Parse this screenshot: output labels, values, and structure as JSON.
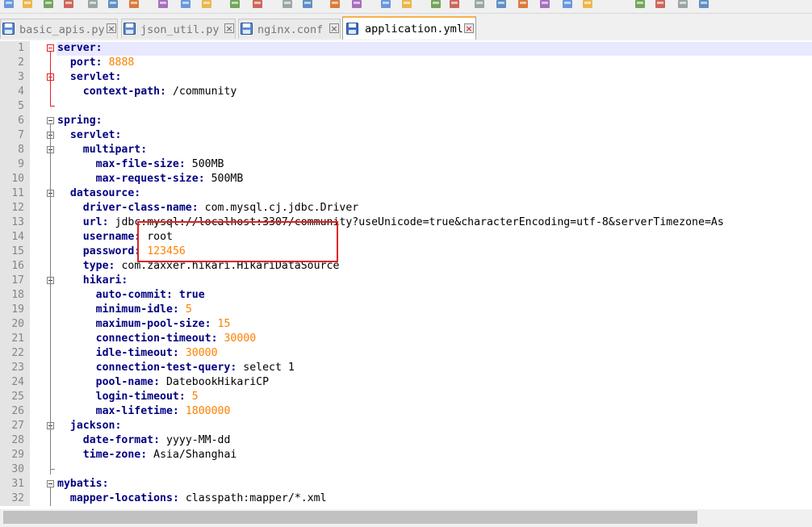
{
  "toolbar": {
    "buttons": [
      "new-file-icon",
      "open-folder-icon",
      "save-icon",
      "save-all-icon",
      "close-icon",
      "close-all-icon",
      "print-icon",
      "cut-icon",
      "copy-icon",
      "paste-icon",
      "undo-icon",
      "redo-icon",
      "find-icon",
      "replace-icon",
      "zoom-in-icon",
      "zoom-out-icon",
      "sync-vertical-icon",
      "sync-horizontal-icon",
      "word-wrap-icon",
      "show-all-chars-icon",
      "indent-guide-icon",
      "document-map-icon",
      "function-list-icon",
      "folder-as-workspace-icon",
      "monitoring-icon",
      "record-macro-icon",
      "stop-recording-icon",
      "playback-macro-icon",
      "run-macro-multiple-icon",
      "save-macro-icon"
    ]
  },
  "tabs": [
    {
      "label": "basic_apis.py",
      "active": false
    },
    {
      "label": "json_util.py",
      "active": false
    },
    {
      "label": "nginx.conf",
      "active": false
    },
    {
      "label": "application.yml",
      "active": true
    }
  ],
  "editor": {
    "lines": [
      {
        "num": "1",
        "indent": 0,
        "key": "server",
        "value": "",
        "vtype": ""
      },
      {
        "num": "2",
        "indent": 2,
        "key": "port",
        "value": "8888",
        "vtype": "num"
      },
      {
        "num": "3",
        "indent": 2,
        "key": "servlet",
        "value": "",
        "vtype": ""
      },
      {
        "num": "4",
        "indent": 4,
        "key": "context-path",
        "value": "/community",
        "vtype": "val"
      },
      {
        "num": "5",
        "indent": 0,
        "key": "",
        "value": "",
        "vtype": ""
      },
      {
        "num": "6",
        "indent": 0,
        "key": "spring",
        "value": "",
        "vtype": ""
      },
      {
        "num": "7",
        "indent": 2,
        "key": "servlet",
        "value": "",
        "vtype": ""
      },
      {
        "num": "8",
        "indent": 4,
        "key": "multipart",
        "value": "",
        "vtype": ""
      },
      {
        "num": "9",
        "indent": 6,
        "key": "max-file-size",
        "value": "500MB",
        "vtype": "val"
      },
      {
        "num": "10",
        "indent": 6,
        "key": "max-request-size",
        "value": "500MB",
        "vtype": "val"
      },
      {
        "num": "11",
        "indent": 2,
        "key": "datasource",
        "value": "",
        "vtype": ""
      },
      {
        "num": "12",
        "indent": 4,
        "key": "driver-class-name",
        "value": "com.mysql.cj.jdbc.Driver",
        "vtype": "val"
      },
      {
        "num": "13",
        "indent": 4,
        "key": "url",
        "value": "jdbc:mysql://localhost:3307/community?useUnicode=true&characterEncoding=utf-8&serverTimezone=As",
        "vtype": "val"
      },
      {
        "num": "14",
        "indent": 4,
        "key": "username",
        "value": "root",
        "vtype": "val"
      },
      {
        "num": "15",
        "indent": 4,
        "key": "password",
        "value": "123456",
        "vtype": "num"
      },
      {
        "num": "16",
        "indent": 4,
        "key": "type",
        "value": "com.zaxxer.hikari.HikariDataSource",
        "vtype": "val"
      },
      {
        "num": "17",
        "indent": 4,
        "key": "hikari",
        "value": "",
        "vtype": ""
      },
      {
        "num": "18",
        "indent": 6,
        "key": "auto-commit",
        "value": "true",
        "vtype": "key"
      },
      {
        "num": "19",
        "indent": 6,
        "key": "minimum-idle",
        "value": "5",
        "vtype": "num"
      },
      {
        "num": "20",
        "indent": 6,
        "key": "maximum-pool-size",
        "value": "15",
        "vtype": "num"
      },
      {
        "num": "21",
        "indent": 6,
        "key": "connection-timeout",
        "value": "30000",
        "vtype": "num"
      },
      {
        "num": "22",
        "indent": 6,
        "key": "idle-timeout",
        "value": "30000",
        "vtype": "num"
      },
      {
        "num": "23",
        "indent": 6,
        "key": "connection-test-query",
        "value": "select 1",
        "vtype": "val"
      },
      {
        "num": "24",
        "indent": 6,
        "key": "pool-name",
        "value": "DatebookHikariCP",
        "vtype": "val"
      },
      {
        "num": "25",
        "indent": 6,
        "key": "login-timeout",
        "value": "5",
        "vtype": "num"
      },
      {
        "num": "26",
        "indent": 6,
        "key": "max-lifetime",
        "value": "1800000",
        "vtype": "num"
      },
      {
        "num": "27",
        "indent": 2,
        "key": "jackson",
        "value": "",
        "vtype": ""
      },
      {
        "num": "28",
        "indent": 4,
        "key": "date-format",
        "value": "yyyy-MM-dd",
        "vtype": "val"
      },
      {
        "num": "29",
        "indent": 4,
        "key": "time-zone",
        "value": "Asia/Shanghai",
        "vtype": "val"
      },
      {
        "num": "30",
        "indent": 0,
        "key": "",
        "value": "",
        "vtype": ""
      },
      {
        "num": "31",
        "indent": 0,
        "key": "mybatis",
        "value": "",
        "vtype": ""
      },
      {
        "num": "32",
        "indent": 2,
        "key": "mapper-locations",
        "value": "classpath:mapper/*.xml",
        "vtype": "val"
      }
    ]
  },
  "colors": {
    "key": "#000080",
    "number": "#ff8000",
    "annotation": "#e02020",
    "active_tab_accent": "#f7b04b",
    "current_line": "#e8e8ff"
  }
}
